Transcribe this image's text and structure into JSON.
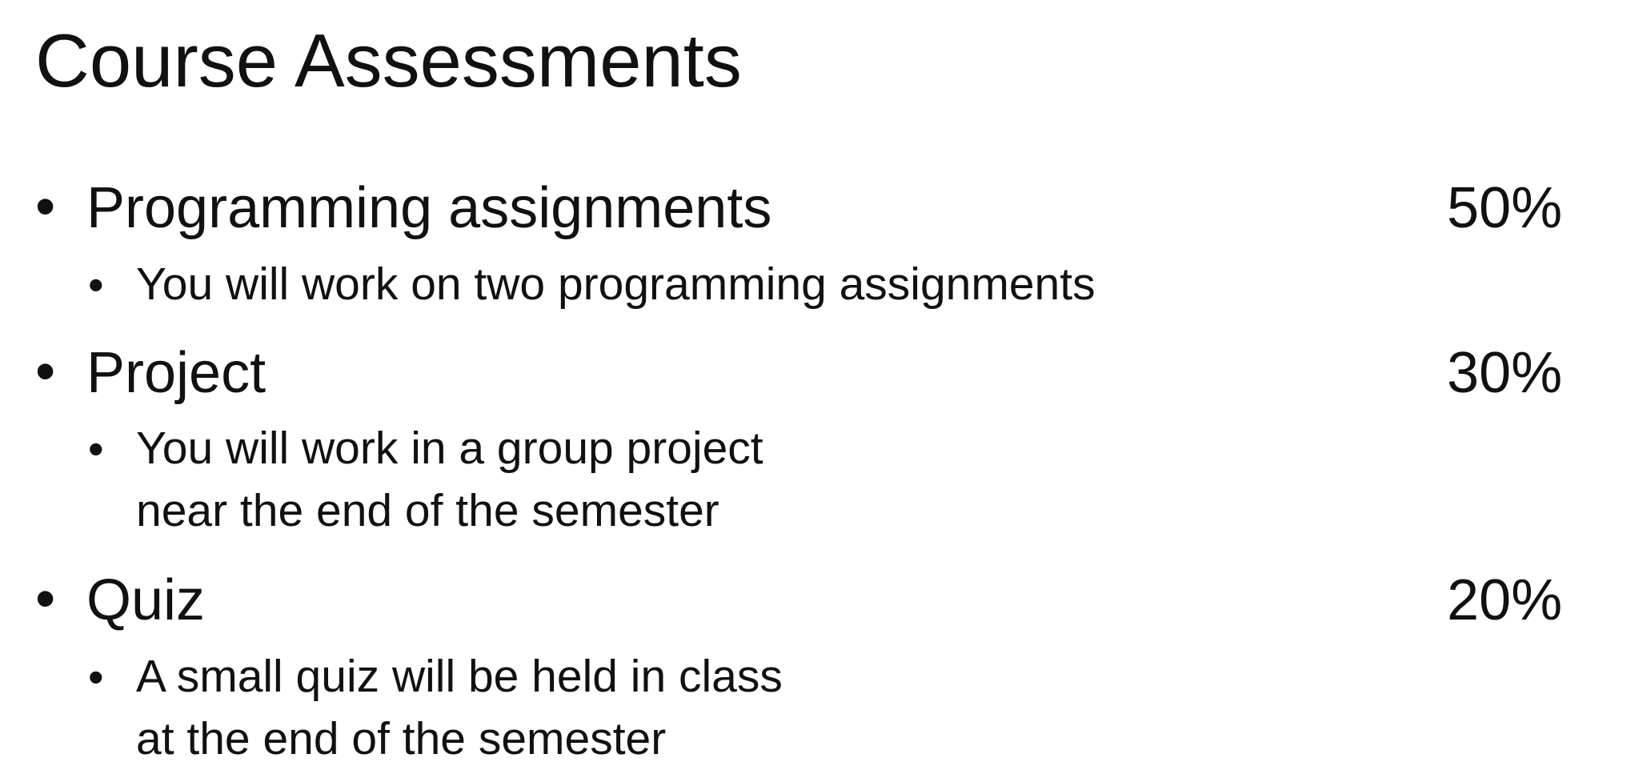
{
  "title": "Course Assessments",
  "bullet_glyph": "•",
  "items": [
    {
      "label": "Programming assignments",
      "weight": "50%",
      "detail": "You will work on two programming assignments"
    },
    {
      "label": "Project",
      "weight": "30%",
      "detail": "You will work in a group project\nnear the end of the semester"
    },
    {
      "label": "Quiz",
      "weight": "20%",
      "detail": "A small quiz will be held in class\nat the end of the semester"
    }
  ]
}
